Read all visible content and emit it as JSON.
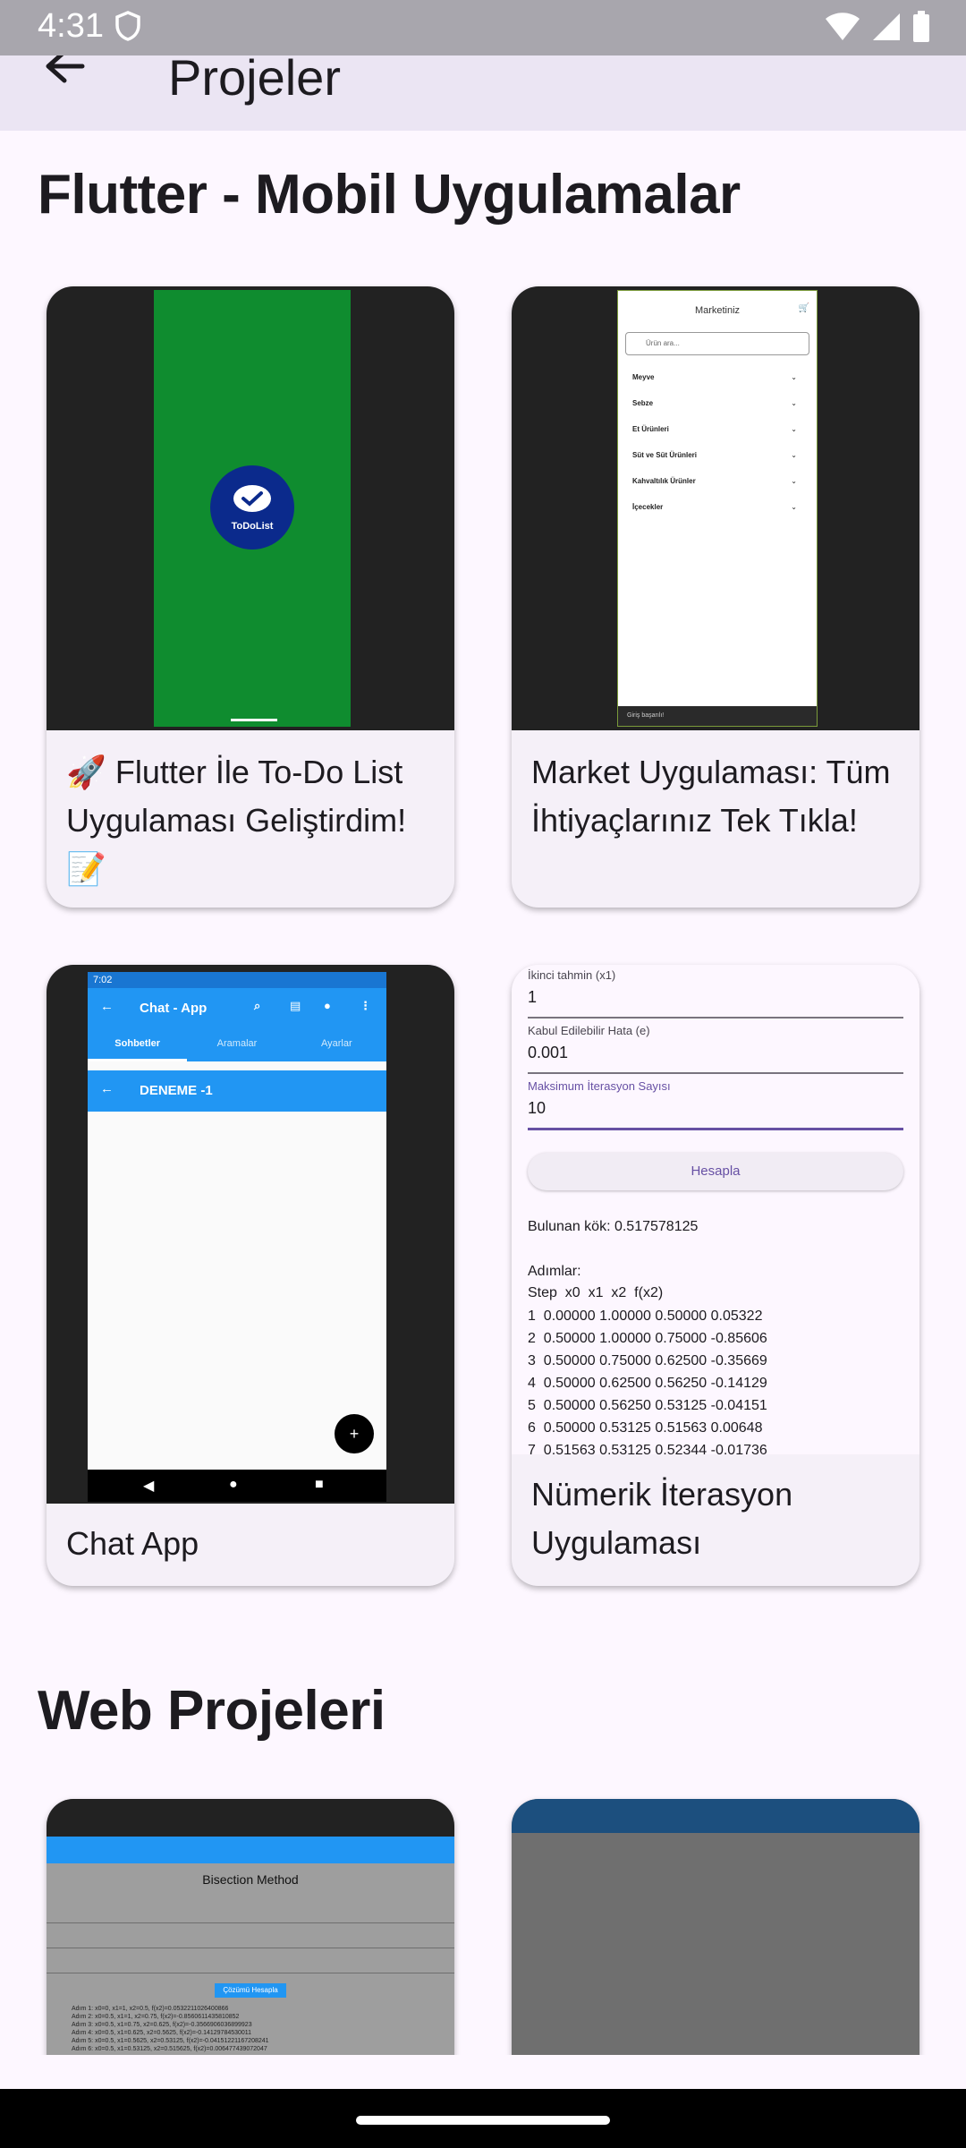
{
  "status_bar": {
    "time": "4:31"
  },
  "app_bar": {
    "title": "Projeler"
  },
  "sections": {
    "flutter": "Flutter - Mobil Uygulamalar",
    "web": "Web Projeleri"
  },
  "cards": {
    "todo": {
      "caption": "🚀 Flutter İle To-Do List Uygulaması Geliştirdim! 📝",
      "logo_text": "ToDoList"
    },
    "market": {
      "caption": "Market Uygulaması: Tüm İhtiyaçlarınız Tek Tıkla!",
      "screen_title": "Marketiniz",
      "search_placeholder": "Ürün ara...",
      "categories": [
        "Meyve",
        "Sebze",
        "Et Ürünleri",
        "Süt ve Süt Ürünleri",
        "Kahvaltılık Ürünler",
        "İçecekler"
      ],
      "bottom_text": "Giriş başarılı!"
    },
    "chat": {
      "caption": "Chat App",
      "status_time": "7:02",
      "bar_title": "Chat - App",
      "tabs": [
        "Sohbetler",
        "Aramalar",
        "Ayarlar"
      ],
      "chat_name": "DENEME -1"
    },
    "numeric": {
      "caption": "Nümerik İterasyon Uygulaması",
      "fields": [
        {
          "label": "İkinci tahmin (x1)",
          "value": "1"
        },
        {
          "label": "Kabul Edilebilir Hata (e)",
          "value": "0.001"
        },
        {
          "label": "Maksimum İterasyon Sayısı",
          "value": "10"
        }
      ],
      "button": "Hesapla",
      "result": "Bulunan kök: 0.517578125",
      "steps_title": "Adımlar:",
      "steps_header": "Step  x0  x1  x2  f(x2)",
      "steps": [
        "1  0.00000 1.00000 0.50000 0.05322",
        "2  0.50000 1.00000 0.75000 -0.85606",
        "3  0.50000 0.75000 0.62500 -0.35669",
        "4  0.50000 0.62500 0.56250 -0.14129",
        "5  0.50000 0.56250 0.53125 -0.04151",
        "6  0.50000 0.53125 0.51563 0.00648",
        "7  0.51563 0.53125 0.52344 -0.01736"
      ]
    },
    "bisection": {
      "heading": "Bisection Method",
      "button": "Çözümü Hesapla",
      "steps": [
        "Adım 1: x0=0, x1=1, x2=0.5, f(x2)=0.0532211026400866",
        "Adım 2: x0=0.5, x1=1, x2=0.75, f(x2)=-0.8560611435810852",
        "Adım 3: x0=0.5, x1=0.75, x2=0.625, f(x2)=-0.3566906036899923",
        "Adım 4: x0=0.5, x1=0.625, x2=0.5625, f(x2)=-0.14129784530011",
        "Adım 5: x0=0.5, x1=0.5625, x2=0.53125, f(x2)=-0.04151221167208241",
        "Adım 6: x0=0.5, x1=0.53125, x2=0.515625, f(x2)=0.006477439072047"
      ]
    }
  }
}
